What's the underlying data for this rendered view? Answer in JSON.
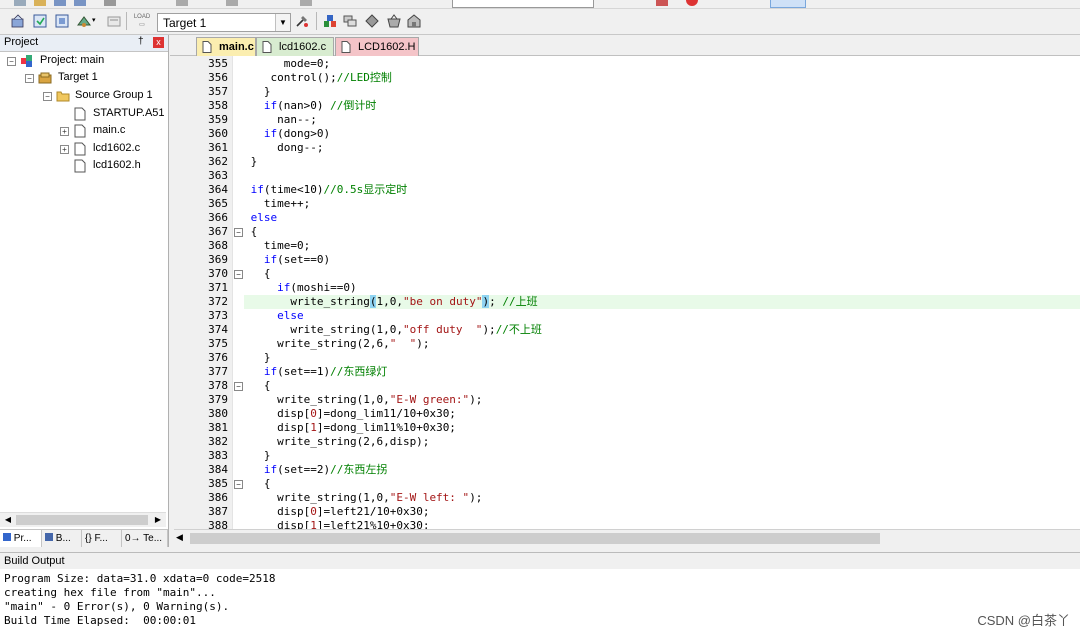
{
  "toolbar": {
    "target": "Target 1"
  },
  "project_panel": {
    "title": "Project",
    "pin": "†",
    "close": "x",
    "tree": [
      {
        "label": "Project: main",
        "depth": 0,
        "expander": "−",
        "icon": "project-icon"
      },
      {
        "label": "Target 1",
        "depth": 1,
        "expander": "−",
        "icon": "target-icon"
      },
      {
        "label": "Source Group 1",
        "depth": 2,
        "expander": "−",
        "icon": "folder-icon"
      },
      {
        "label": "STARTUP.A51",
        "depth": 3,
        "expander": "",
        "icon": "file-icon"
      },
      {
        "label": "main.c",
        "depth": 3,
        "expander": "+",
        "icon": "file-icon"
      },
      {
        "label": "lcd1602.c",
        "depth": 3,
        "expander": "+",
        "icon": "file-icon"
      },
      {
        "label": "lcd1602.h",
        "depth": 3,
        "expander": "",
        "icon": "file-icon"
      }
    ],
    "tabs": [
      "Pr...",
      "B...",
      "{} F...",
      "0→ Te..."
    ]
  },
  "editor_tabs": [
    {
      "label": "main.c",
      "active": true,
      "color": "#fbeeb0"
    },
    {
      "label": "lcd1602.c",
      "active": false,
      "color": "#d8ecd0"
    },
    {
      "label": "LCD1602.H",
      "active": false,
      "color": "#f4c4c8"
    }
  ],
  "code": {
    "highlight_line": 372,
    "lines": [
      {
        "n": 355,
        "fold": "",
        "text": [
          [
            "      mode=0;",
            ""
          ]
        ]
      },
      {
        "n": 356,
        "fold": "",
        "text": [
          [
            "    control();",
            ""
          ],
          [
            "//LED控制",
            "cm"
          ]
        ]
      },
      {
        "n": 357,
        "fold": "",
        "text": [
          [
            "   }",
            ""
          ]
        ]
      },
      {
        "n": 358,
        "fold": "",
        "text": [
          [
            "   ",
            ""
          ],
          [
            "if",
            "kw"
          ],
          [
            "(nan>0) ",
            ""
          ],
          [
            "//倒计时",
            "cm"
          ]
        ]
      },
      {
        "n": 359,
        "fold": "",
        "text": [
          [
            "     nan--;",
            ""
          ]
        ]
      },
      {
        "n": 360,
        "fold": "",
        "text": [
          [
            "   ",
            ""
          ],
          [
            "if",
            "kw"
          ],
          [
            "(dong>0)",
            ""
          ]
        ]
      },
      {
        "n": 361,
        "fold": "",
        "text": [
          [
            "     dong--;",
            ""
          ]
        ]
      },
      {
        "n": 362,
        "fold": "",
        "text": [
          [
            " }",
            ""
          ]
        ]
      },
      {
        "n": 363,
        "fold": "",
        "text": [
          [
            "",
            ""
          ]
        ]
      },
      {
        "n": 364,
        "fold": "",
        "text": [
          [
            " ",
            ""
          ],
          [
            "if",
            "kw"
          ],
          [
            "(time<10)",
            ""
          ],
          [
            "//0.5s显示定时",
            "cm"
          ]
        ]
      },
      {
        "n": 365,
        "fold": "",
        "text": [
          [
            "   time++;",
            ""
          ]
        ]
      },
      {
        "n": 366,
        "fold": "",
        "text": [
          [
            " ",
            ""
          ],
          [
            "else",
            "kw"
          ]
        ]
      },
      {
        "n": 367,
        "fold": "-",
        "text": [
          [
            " {",
            ""
          ]
        ]
      },
      {
        "n": 368,
        "fold": "",
        "text": [
          [
            "   time=0;",
            ""
          ]
        ]
      },
      {
        "n": 369,
        "fold": "",
        "text": [
          [
            "   ",
            ""
          ],
          [
            "if",
            "kw"
          ],
          [
            "(set==0)",
            ""
          ]
        ]
      },
      {
        "n": 370,
        "fold": "-",
        "text": [
          [
            "   {",
            ""
          ]
        ]
      },
      {
        "n": 371,
        "fold": "",
        "text": [
          [
            "     ",
            ""
          ],
          [
            "if",
            "kw"
          ],
          [
            "(moshi==0)",
            ""
          ]
        ]
      },
      {
        "n": 372,
        "fold": "",
        "text": [
          [
            "       write_string",
            ""
          ],
          [
            "(",
            "br"
          ],
          [
            "1,0,",
            ""
          ],
          [
            "\"be on duty\"",
            "str"
          ],
          [
            ")",
            "br"
          ],
          [
            "; ",
            ""
          ],
          [
            "//上班",
            "cm"
          ]
        ]
      },
      {
        "n": 373,
        "fold": "",
        "text": [
          [
            "     ",
            ""
          ],
          [
            "else",
            "kw"
          ]
        ]
      },
      {
        "n": 374,
        "fold": "",
        "text": [
          [
            "       write_string(1,0,",
            ""
          ],
          [
            "\"off duty  \"",
            "str"
          ],
          [
            ");",
            ""
          ],
          [
            "//不上班",
            "cm"
          ]
        ]
      },
      {
        "n": 375,
        "fold": "",
        "text": [
          [
            "     write_string(2,6,",
            ""
          ],
          [
            "\"  \"",
            "str"
          ],
          [
            ");",
            ""
          ]
        ]
      },
      {
        "n": 376,
        "fold": "",
        "text": [
          [
            "   }",
            ""
          ]
        ]
      },
      {
        "n": 377,
        "fold": "",
        "text": [
          [
            "   ",
            ""
          ],
          [
            "if",
            "kw"
          ],
          [
            "(set==1)",
            ""
          ],
          [
            "//东西绿灯",
            "cm"
          ]
        ]
      },
      {
        "n": 378,
        "fold": "-",
        "text": [
          [
            "   {",
            ""
          ]
        ]
      },
      {
        "n": 379,
        "fold": "",
        "text": [
          [
            "     write_string(1,0,",
            ""
          ],
          [
            "\"E-W green:\"",
            "str"
          ],
          [
            ");",
            ""
          ]
        ]
      },
      {
        "n": 380,
        "fold": "",
        "text": [
          [
            "     disp[",
            ""
          ],
          [
            "0",
            "str"
          ],
          [
            "]=dong_lim11/10+0x30;",
            ""
          ]
        ]
      },
      {
        "n": 381,
        "fold": "",
        "text": [
          [
            "     disp[",
            ""
          ],
          [
            "1",
            "str"
          ],
          [
            "]=dong_lim11%10+0x30;",
            ""
          ]
        ]
      },
      {
        "n": 382,
        "fold": "",
        "text": [
          [
            "     write_string(2,6,disp);",
            ""
          ]
        ]
      },
      {
        "n": 383,
        "fold": "",
        "text": [
          [
            "   }",
            ""
          ]
        ]
      },
      {
        "n": 384,
        "fold": "",
        "text": [
          [
            "   ",
            ""
          ],
          [
            "if",
            "kw"
          ],
          [
            "(set==2)",
            ""
          ],
          [
            "//东西左拐",
            "cm"
          ]
        ]
      },
      {
        "n": 385,
        "fold": "-",
        "text": [
          [
            "   {",
            ""
          ]
        ]
      },
      {
        "n": 386,
        "fold": "",
        "text": [
          [
            "     write_string(1,0,",
            ""
          ],
          [
            "\"E-W left: \"",
            "str"
          ],
          [
            ");",
            ""
          ]
        ]
      },
      {
        "n": 387,
        "fold": "",
        "text": [
          [
            "     disp[",
            ""
          ],
          [
            "0",
            "str"
          ],
          [
            "]=left21/10+0x30;",
            ""
          ]
        ]
      },
      {
        "n": 388,
        "fold": "",
        "text": [
          [
            "     disp[",
            ""
          ],
          [
            "1",
            "str"
          ],
          [
            "]=left21%10+0x30;",
            ""
          ]
        ]
      }
    ]
  },
  "build_output": {
    "title": "Build Output",
    "lines": [
      "Program Size: data=31.0 xdata=0 code=2518",
      "creating hex file from \"main\"...",
      "\"main\" - 0 Error(s), 0 Warning(s).",
      "Build Time Elapsed:  00:00:01"
    ]
  },
  "watermark": "CSDN @白茶丫"
}
